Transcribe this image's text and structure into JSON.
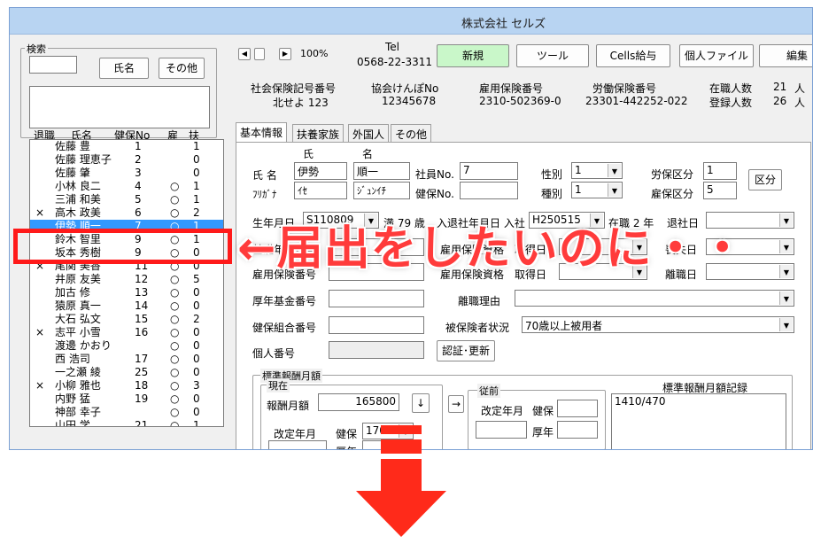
{
  "window": {
    "title": "株式会社 セルズ"
  },
  "search": {
    "legend": "検索",
    "name_button": "氏名",
    "other_button": "その他"
  },
  "list": {
    "headers": {
      "retired": "退職",
      "name": "氏名",
      "kenpo_no": "健保No",
      "employ": "雇",
      "dependents": "扶"
    },
    "rows": [
      {
        "mark": "",
        "name": "佐藤 豊",
        "no": "1",
        "emp": "",
        "dep": "1"
      },
      {
        "mark": "",
        "name": "佐藤 理恵子",
        "no": "2",
        "emp": "",
        "dep": "0"
      },
      {
        "mark": "",
        "name": "佐藤 肇",
        "no": "3",
        "emp": "",
        "dep": "0"
      },
      {
        "mark": "",
        "name": "小林 良二",
        "no": "4",
        "emp": "○",
        "dep": "1"
      },
      {
        "mark": "",
        "name": "三浦 和美",
        "no": "5",
        "emp": "○",
        "dep": "1"
      },
      {
        "mark": "×",
        "name": "高木 政美",
        "no": "6",
        "emp": "○",
        "dep": "2"
      },
      {
        "mark": "",
        "name": "伊勢 順一",
        "no": "7",
        "emp": "○",
        "dep": "1",
        "selected": true
      },
      {
        "mark": "",
        "name": "鈴木 智里",
        "no": "9",
        "emp": "○",
        "dep": "1"
      },
      {
        "mark": "",
        "name": "坂本 秀樹",
        "no": "9",
        "emp": "○",
        "dep": "0"
      },
      {
        "mark": "×",
        "name": "尾関 美香",
        "no": "11",
        "emp": "○",
        "dep": "0"
      },
      {
        "mark": "",
        "name": "井原 友美",
        "no": "12",
        "emp": "○",
        "dep": "5"
      },
      {
        "mark": "",
        "name": "加古 修",
        "no": "13",
        "emp": "○",
        "dep": "0"
      },
      {
        "mark": "",
        "name": "猿原 真一",
        "no": "14",
        "emp": "○",
        "dep": "0"
      },
      {
        "mark": "",
        "name": "大石 弘文",
        "no": "15",
        "emp": "○",
        "dep": "2"
      },
      {
        "mark": "×",
        "name": "志平 小雪",
        "no": "16",
        "emp": "○",
        "dep": "0"
      },
      {
        "mark": "",
        "name": "渡邊 かおり",
        "no": "",
        "emp": "○",
        "dep": "0"
      },
      {
        "mark": "",
        "name": "西 浩司",
        "no": "17",
        "emp": "○",
        "dep": "0"
      },
      {
        "mark": "",
        "name": "一之瀬 綾",
        "no": "25",
        "emp": "○",
        "dep": "0"
      },
      {
        "mark": "×",
        "name": "小柳 雅也",
        "no": "18",
        "emp": "○",
        "dep": "3"
      },
      {
        "mark": "",
        "name": "内野 猛",
        "no": "19",
        "emp": "○",
        "dep": "0"
      },
      {
        "mark": "",
        "name": "神部 幸子",
        "no": "",
        "emp": "○",
        "dep": "0"
      },
      {
        "mark": "",
        "name": "山田 学",
        "no": "21",
        "emp": "○",
        "dep": "1"
      }
    ]
  },
  "toolbar": {
    "zoom": "100%",
    "tel_label": "Tel",
    "tel": "0568-22-3311",
    "new": "新規",
    "tool": "ツール",
    "cells_pay": "Cells給与",
    "personal_file": "個人ファイル",
    "edit": "編集"
  },
  "company": {
    "shaho_label": "社会保険記号番号",
    "shaho_value": "北せよ 123",
    "kyokai_label": "協会けんぽNo",
    "kyokai_value": "12345678",
    "koyo_label": "雇用保険番号",
    "koyo_value": "2310-502369-0",
    "rodo_label": "労働保険番号",
    "rodo_value": "23301-442252-022",
    "zaishoku_label": "在職人数",
    "zaishoku_value": "21",
    "toroku_label": "登録人数",
    "toroku_value": "26",
    "unit": "人"
  },
  "tabs": [
    "基本情報",
    "扶養家族",
    "外国人",
    "その他"
  ],
  "form": {
    "shi_label": "氏",
    "mei_label": "名",
    "name_label": "氏 名",
    "kana_label": "ﾌﾘｶﾞﾅ",
    "last_name": "伊勢",
    "first_name": "順一",
    "last_kana": "ｲｾ",
    "first_kana": "ｼﾞｭﾝｲﾁ",
    "emp_no_label": "社員No.",
    "emp_no": "7",
    "kenpo_no_label": "健保No.",
    "kenpo_no": "",
    "gender_label": "性別",
    "gender": "1",
    "type_label": "種別",
    "type": "1",
    "rouho_label": "労保区分",
    "rouho": "1",
    "koho_label": "雇保区分",
    "koho": "5",
    "kubun_button": "区分",
    "birth_label": "生年月日",
    "birth": "S110809",
    "age": "満 79 歳",
    "join_label": "入退社年月日 入社",
    "join_date": "H250515",
    "tenure": "在職 2 年",
    "leave_label": "退社日",
    "kiso_label": "基礎年金番号",
    "koyo_shikaku_label": "雇用保険資格",
    "shutoku_label": "取得日",
    "sonshitsu_label": "喪失日",
    "koyo_hihoken_label": "雇用保険番号",
    "koyo_shikaku2_label": "雇用保険資格",
    "shutoku2_label": "取得日",
    "rishoku_date_label": "離職日",
    "kosei_label": "厚年基金番号",
    "rishoku_reason_label": "離職理由",
    "kenpo_kumiai_label": "健保組合番号",
    "hihoken_label": "被保険者状況",
    "hihoken_value": "70歳以上被用者",
    "kojin_label": "個人番号",
    "auth_button": "認証･更新",
    "hyojun_legend": "標準報酬月額",
    "genzai_legend": "現在",
    "hoshu_label": "報酬月額",
    "hoshu_value": "165800",
    "down_arrow": "↓",
    "right_arrow": "→",
    "kaitei_label": "改定年月",
    "kenpo_label": "健保",
    "kenpo_value": "170",
    "konen_label": "厚年",
    "juzen_legend": "従前",
    "juzen_kaitei_label": "改定年月",
    "juzen_kenpo_label": "健保",
    "juzen_konen_label": "厚年",
    "record_label": "標準報酬月額記録",
    "record_value": "1410/470"
  },
  "annotation": {
    "text": "←届出をしたいのに・・",
    "color": "#ff3b3b"
  }
}
